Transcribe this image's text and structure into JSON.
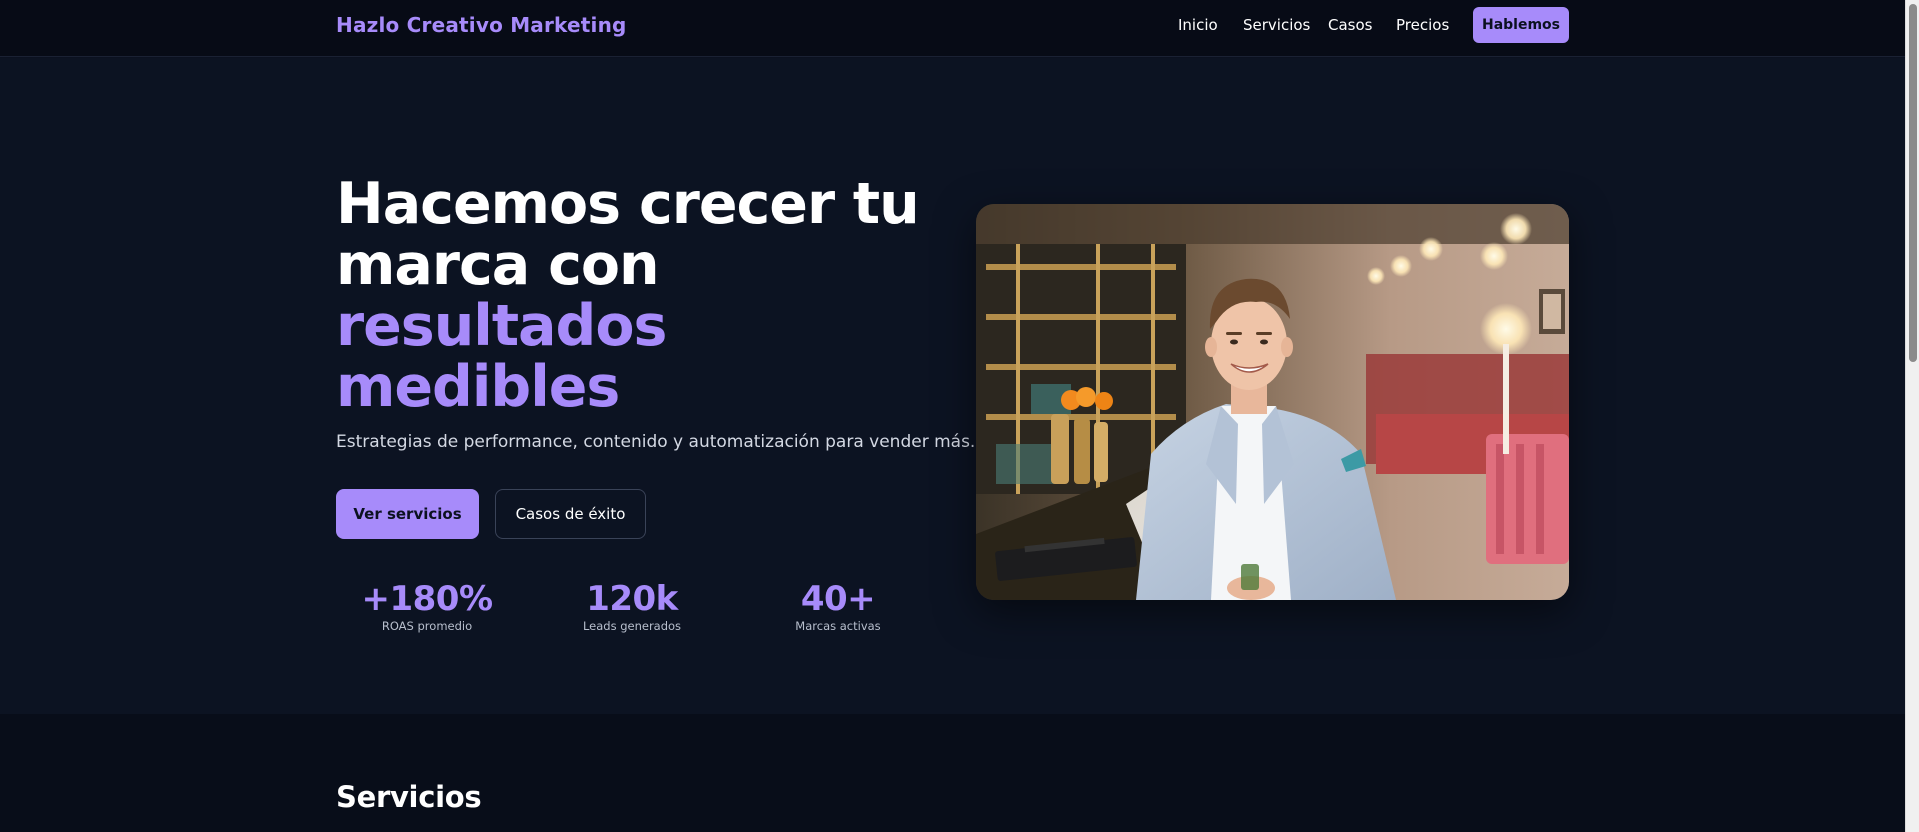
{
  "nav": {
    "brand": "Hazlo Creativo Marketing",
    "links": [
      "Inicio",
      "Servicios",
      "Casos",
      "Precios"
    ],
    "cta": "Hablemos"
  },
  "hero": {
    "headline_line1": "Hacemos crecer tu",
    "headline_line2": "marca con",
    "headline_accent1": "resultados",
    "headline_accent2": "medibles",
    "subhead": "Estrategias de performance, contenido y automatización para vender más.",
    "primary_button": "Ver servicios",
    "secondary_button": "Casos de éxito",
    "stats": [
      {
        "value": "+180%",
        "label": "ROAS promedio"
      },
      {
        "value": "120k",
        "label": "Leads generados"
      },
      {
        "value": "40+",
        "label": "Marcas activas"
      }
    ]
  },
  "services": {
    "title": "Servicios"
  },
  "colors": {
    "accent": "#a78bfa",
    "background": "#0c1322",
    "nav_background": "#070b16"
  }
}
